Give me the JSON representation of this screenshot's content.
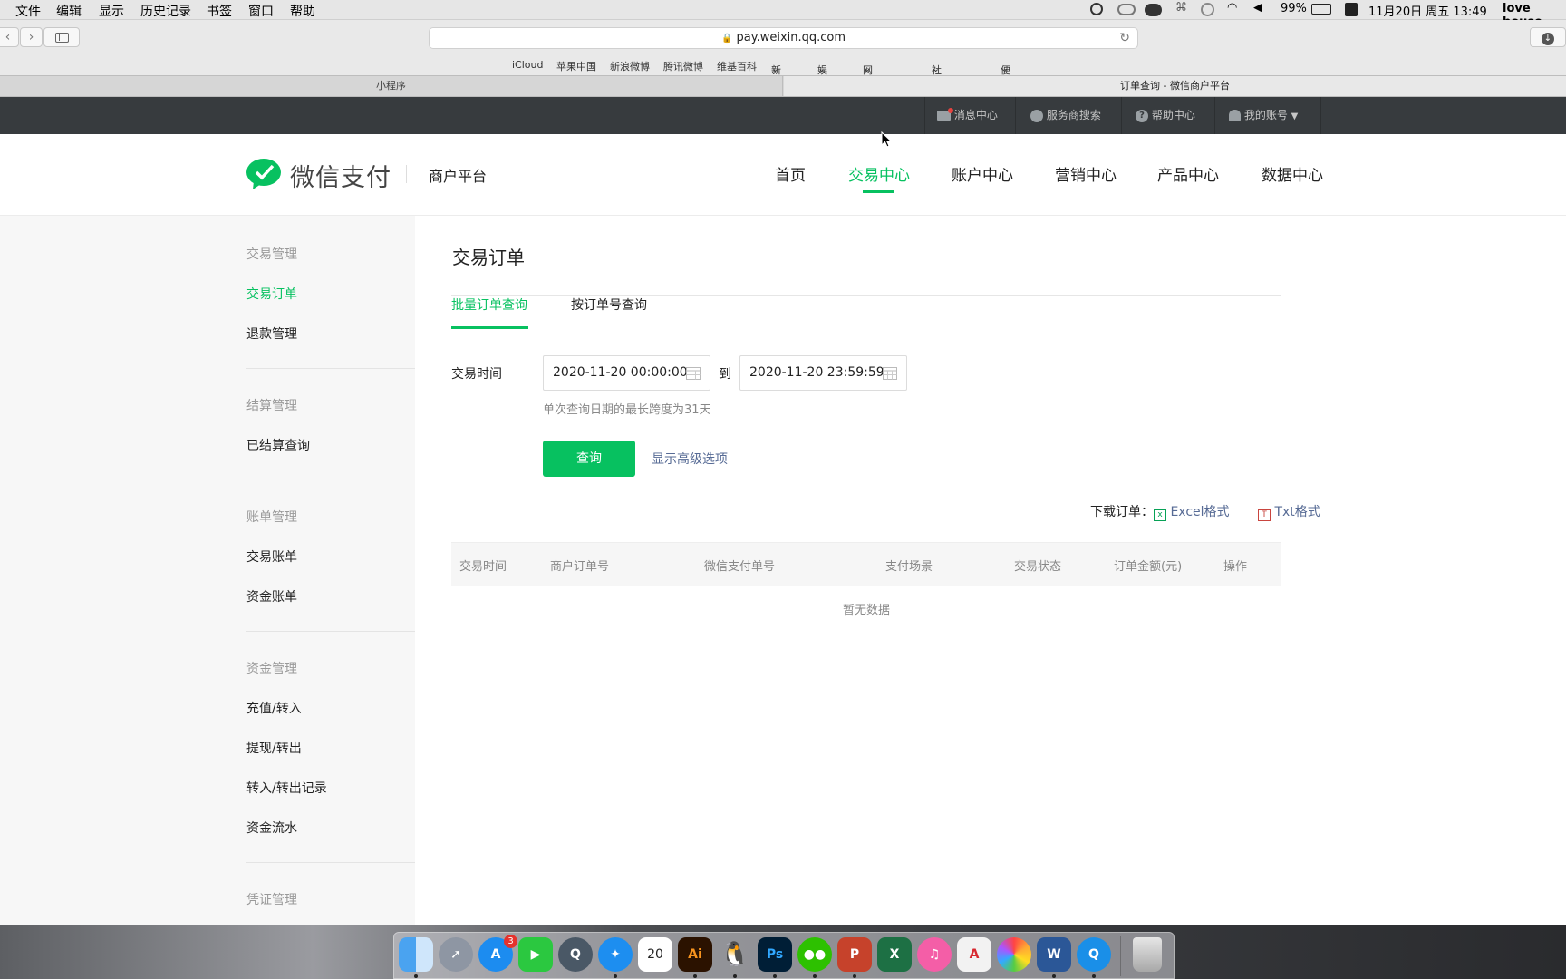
{
  "menubar": {
    "items": [
      "文件",
      "编辑",
      "显示",
      "历史记录",
      "书签",
      "窗口",
      "帮助"
    ],
    "battery": "99%",
    "datetime": "11月20日 周五 13:49",
    "user": "love house"
  },
  "browser": {
    "url": "pay.weixin.qq.com",
    "favorites": [
      "iCloud",
      "苹果中国",
      "新浪微博",
      "腾讯微博",
      "维基百科",
      "新闻",
      "娱乐",
      "网购.团购",
      "社区.交友",
      "便民.服务"
    ],
    "tabs": [
      "小程序",
      "订单查询 - 微信商户平台"
    ]
  },
  "topbar": {
    "messages": "消息中心",
    "provider_search": "服务商搜索",
    "help": "帮助中心",
    "account": "我的账号"
  },
  "header": {
    "logo_text": "微信支付",
    "platform": "商户平台",
    "nav": [
      "首页",
      "交易中心",
      "账户中心",
      "营销中心",
      "产品中心",
      "数据中心"
    ],
    "active_nav": "交易中心"
  },
  "sidebar": {
    "group1": "交易管理",
    "g1_items": [
      "交易订单",
      "退款管理"
    ],
    "group2": "结算管理",
    "g2_items": [
      "已结算查询"
    ],
    "group3": "账单管理",
    "g3_items": [
      "交易账单",
      "资金账单"
    ],
    "group4": "资金管理",
    "g4_items": [
      "充值/转入",
      "提现/转出",
      "转入/转出记录",
      "资金流水"
    ],
    "group5": "凭证管理"
  },
  "main": {
    "title": "交易订单",
    "tabs": [
      "批量订单查询",
      "按订单号查询"
    ],
    "time_label": "交易时间",
    "start_time": "2020-11-20 00:00:00",
    "to": "到",
    "end_time": "2020-11-20 23:59:59",
    "hint": "单次查询日期的最长跨度为31天",
    "query_button": "查询",
    "advanced_link": "显示高级选项",
    "download_label": "下载订单：",
    "excel": "Excel格式",
    "txt": "Txt格式",
    "table_headers": [
      "交易时间",
      "商户订单号",
      "微信支付单号",
      "支付场景",
      "交易状态",
      "订单金额(元)",
      "操作"
    ],
    "empty": "暂无数据"
  },
  "dock": {
    "badge": "3",
    "calendar_day": "20",
    "apps": [
      "finder-icon",
      "launchpad-icon",
      "app-store-icon",
      "facetime-icon",
      "quicktime-icon",
      "safari-icon",
      "calendar-icon",
      "illustrator-icon",
      "qq-icon",
      "photoshop-icon",
      "wechat-icon",
      "powerpoint-icon",
      "excel-icon",
      "itunes-icon",
      "acrobat-icon",
      "photos-icon",
      "word-icon",
      "qq-browser-icon",
      "trash-icon"
    ]
  },
  "colors": {
    "wechat_green": "#07c160",
    "link_blue": "#576b95",
    "dark_bar": "#373b3e"
  }
}
